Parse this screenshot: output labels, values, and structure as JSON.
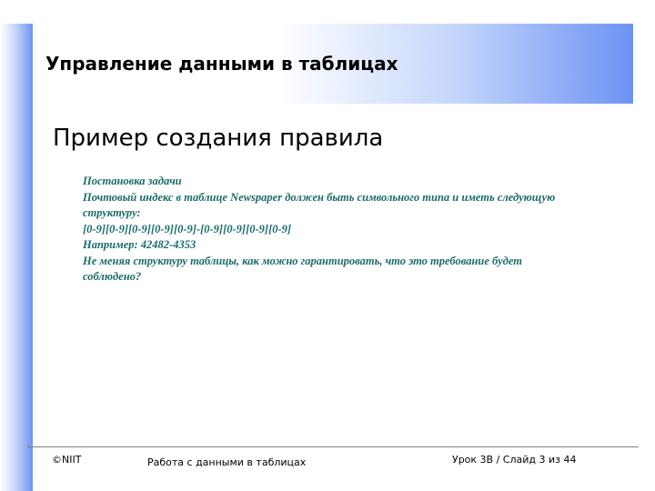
{
  "header": {
    "title": "Управление данными в таблицах"
  },
  "content": {
    "subtitle": "Пример создания правила",
    "lines": [
      "Постановка задачи",
      "Почтовый индекс в таблице Newspaper должен быть символьного типа и иметь следующую",
      "структуру:",
      "[0-9][0-9][0-9][0-9][0-9]-[0-9][0-9][0-9][0-9]",
      "Например: 42482-4353",
      "Не меняя структуру таблицы, как можно гарантировать, что это требование будет",
      "соблюдено?"
    ]
  },
  "footer": {
    "left": "©NIIT",
    "center": "Работа с данными в таблицах",
    "right": "Урок 3В / Слайд 3 из 44"
  },
  "colors": {
    "accent_blue": "#6f94f2",
    "body_text": "#1a6b6b"
  }
}
